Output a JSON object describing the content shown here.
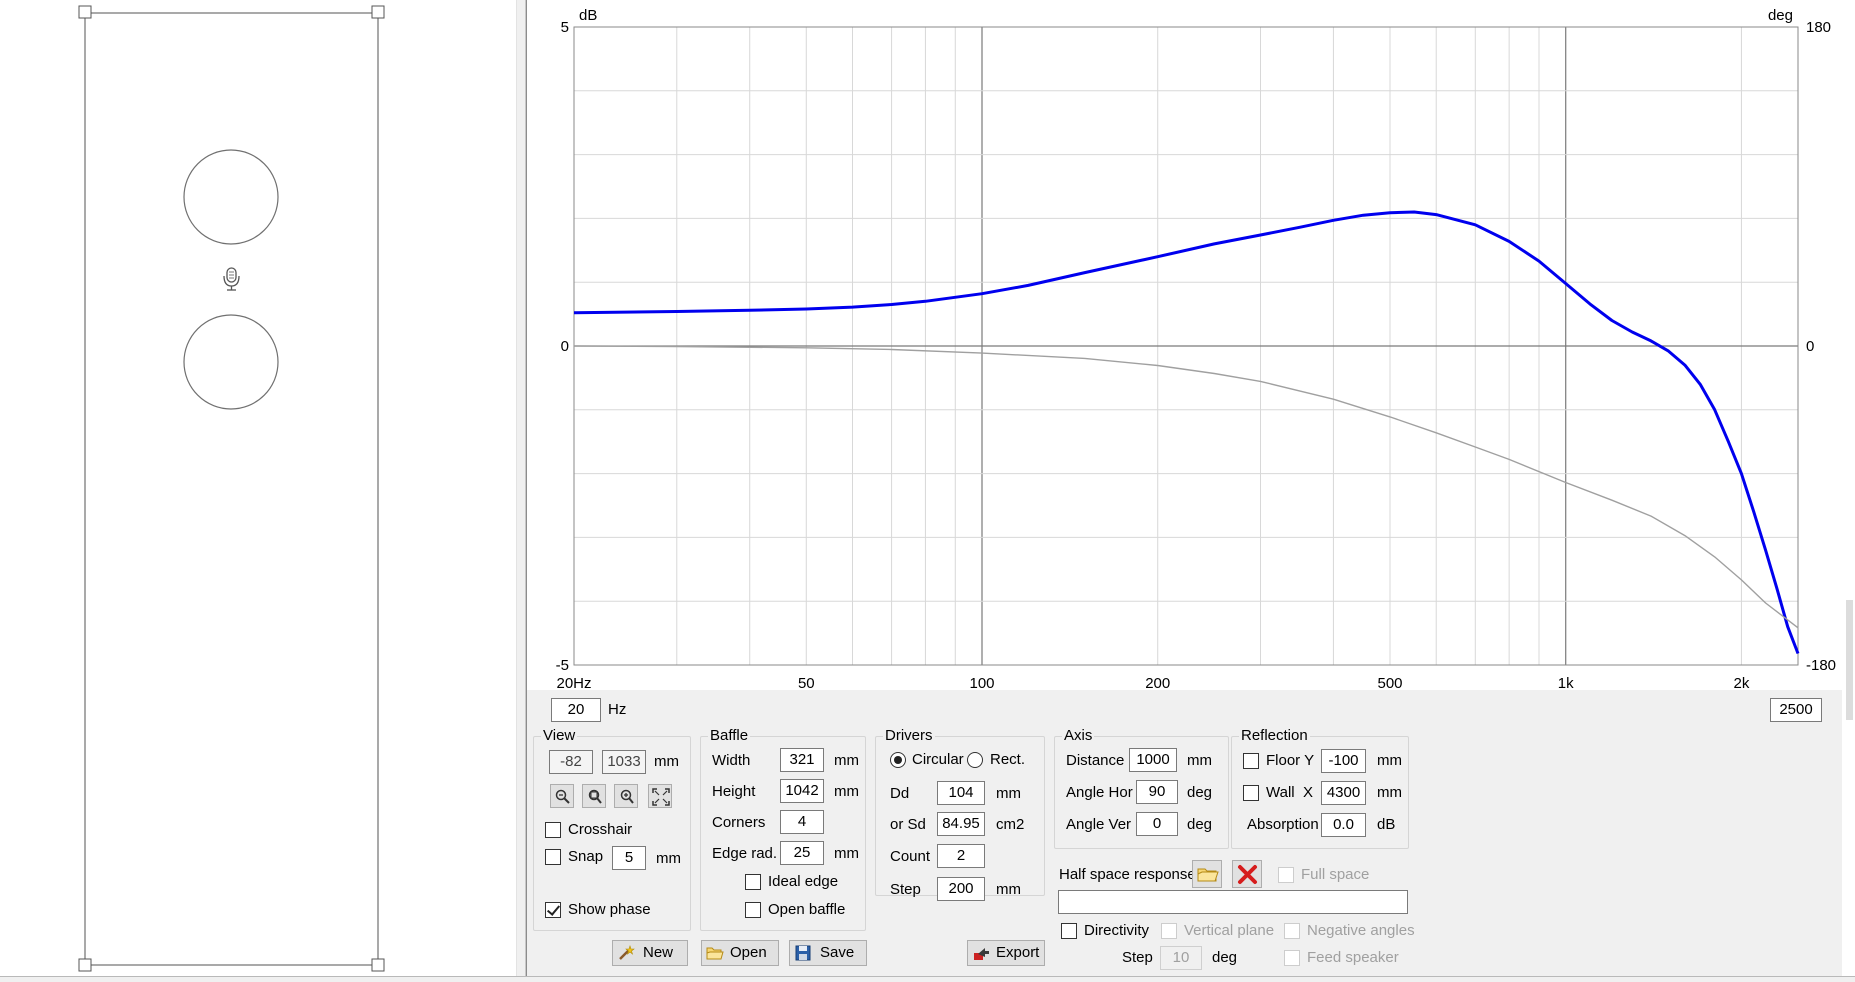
{
  "chart_data": {
    "type": "line",
    "x_scale": "log",
    "xlim": [
      20,
      2500
    ],
    "ylim_left": [
      -5,
      5
    ],
    "ylim_right": [
      -180,
      180
    ],
    "ylabel_left": "dB",
    "ylabel_right": "deg",
    "x_ticks": [
      {
        "value": 20,
        "label": "20Hz"
      },
      {
        "value": 50,
        "label": "50"
      },
      {
        "value": 100,
        "label": "100"
      },
      {
        "value": 200,
        "label": "200"
      },
      {
        "value": 500,
        "label": "500"
      },
      {
        "value": 1000,
        "label": "1k"
      },
      {
        "value": 2000,
        "label": "2k"
      }
    ],
    "y_ticks_left": [
      "5",
      "0",
      "-5"
    ],
    "y_ticks_right": [
      "180",
      "0",
      "-180"
    ],
    "grid": true,
    "series": [
      {
        "color": "#0000ee",
        "axis": "left",
        "x": [
          20,
          30,
          40,
          50,
          60,
          70,
          80,
          100,
          120,
          150,
          200,
          250,
          300,
          350,
          400,
          450,
          500,
          550,
          600,
          700,
          800,
          900,
          1000,
          1100,
          1200,
          1300,
          1400,
          1500,
          1600,
          1700,
          1800,
          1900,
          2000,
          2100,
          2200,
          2300,
          2400,
          2500
        ],
        "y": [
          0.52,
          0.54,
          0.56,
          0.58,
          0.61,
          0.65,
          0.7,
          0.82,
          0.95,
          1.15,
          1.4,
          1.6,
          1.74,
          1.86,
          1.97,
          2.05,
          2.09,
          2.1,
          2.06,
          1.9,
          1.64,
          1.33,
          0.98,
          0.66,
          0.4,
          0.22,
          0.08,
          -0.08,
          -0.3,
          -0.6,
          -1.0,
          -1.5,
          -2.0,
          -2.6,
          -3.2,
          -3.8,
          -4.4,
          -4.82
        ]
      },
      {
        "color": "#a0a0a0",
        "axis": "right",
        "x": [
          20,
          30,
          50,
          70,
          100,
          150,
          200,
          250,
          300,
          400,
          500,
          600,
          700,
          800,
          1000,
          1200,
          1400,
          1600,
          1800,
          2000,
          2200,
          2500
        ],
        "y": [
          0,
          -0.3,
          -1.0,
          -2.0,
          -4.0,
          -7.0,
          -11.0,
          -15.5,
          -20.0,
          -30.0,
          -40.0,
          -49.0,
          -57.0,
          -64.0,
          -77.0,
          -87.0,
          -96.0,
          -107.0,
          -119.0,
          -132.0,
          -145.0,
          -159.0
        ]
      }
    ]
  },
  "freq": {
    "min_value": "20",
    "unit": "Hz",
    "max_value": "2500"
  },
  "view": {
    "title": "View",
    "x": "-82",
    "y": "1033",
    "unit": "mm",
    "crosshair_label": "Crosshair",
    "snap_label": "Snap",
    "snap_value": "5",
    "snap_unit": "mm",
    "show_phase_label": "Show phase"
  },
  "baffle": {
    "title": "Baffle",
    "width_label": "Width",
    "width": "321",
    "height_label": "Height",
    "height": "1042",
    "corners_label": "Corners",
    "corners": "4",
    "edge_label": "Edge rad.",
    "edge": "25",
    "unit": "mm",
    "ideal_edge_label": "Ideal edge",
    "open_baffle_label": "Open baffle"
  },
  "drivers": {
    "title": "Drivers",
    "circular_label": "Circular",
    "rect_label": "Rect.",
    "dd_label": "Dd",
    "dd": "104",
    "dd_unit": "mm",
    "sd_label": "or Sd",
    "sd": "84.95",
    "sd_unit": "cm2",
    "count_label": "Count",
    "count": "2",
    "step_label": "Step",
    "step": "200",
    "step_unit": "mm"
  },
  "axis": {
    "title": "Axis",
    "distance_label": "Distance",
    "distance": "1000",
    "distance_unit": "mm",
    "hor_label": "Angle Hor",
    "hor": "90",
    "hor_unit": "deg",
    "ver_label": "Angle Ver",
    "ver": "0",
    "ver_unit": "deg"
  },
  "reflection": {
    "title": "Reflection",
    "floor_label": "Floor Y",
    "floor": "-100",
    "floor_unit": "mm",
    "wall_label": "Wall  X",
    "wall": "4300",
    "wall_unit": "mm",
    "absorption_label": "Absorption",
    "absorption": "0.0",
    "absorption_unit": "dB"
  },
  "halfspace": {
    "label": "Half space response",
    "full_space_label": "Full space",
    "path": ""
  },
  "directivity": {
    "label": "Directivity",
    "vertical_label": "Vertical plane",
    "negative_label": "Negative angles",
    "step_label": "Step",
    "step": "10",
    "step_unit": "deg",
    "feed_label": "Feed speaker"
  },
  "buttons": {
    "new": "New",
    "open": "Open",
    "save": "Save",
    "export": "Export"
  }
}
